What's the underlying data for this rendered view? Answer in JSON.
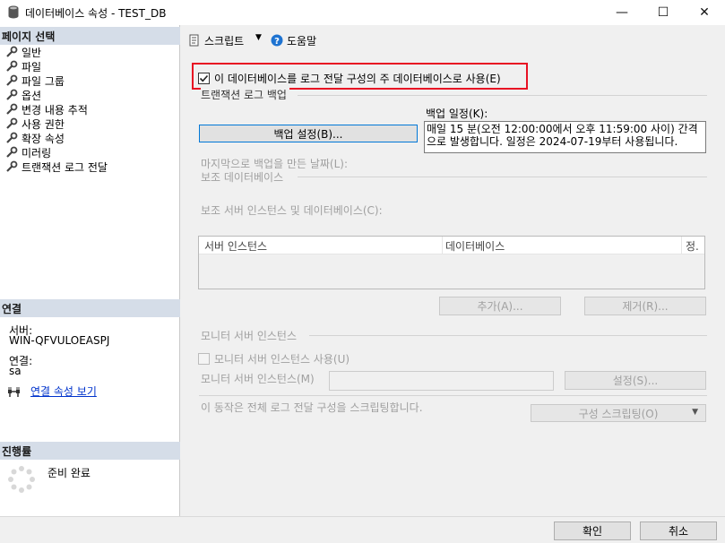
{
  "window": {
    "title": "데이터베이스 속성 - TEST_DB",
    "minimize": "—",
    "maximize": "☐",
    "close": "✕"
  },
  "left": {
    "page_select_header": "페이지 선택",
    "pages": [
      {
        "label": "일반"
      },
      {
        "label": "파일"
      },
      {
        "label": "파일 그룹"
      },
      {
        "label": "옵션"
      },
      {
        "label": "변경 내용 추적"
      },
      {
        "label": "사용 권한"
      },
      {
        "label": "확장 속성"
      },
      {
        "label": "미러링"
      },
      {
        "label": "트랜잭션 로그 전달"
      }
    ],
    "connection_header": "연결",
    "server_label": "서버:",
    "server_value": "WIN-QFVULOEASPJ",
    "connection_label": "연결:",
    "connection_value": "sa",
    "view_connection_properties": "연결 속성 보기",
    "progress_header": "진행률",
    "progress_status": "준비 완료"
  },
  "toolbar": {
    "script_label": "스크립트",
    "help_label": "도움말"
  },
  "main": {
    "enable_checkbox_label": "이 데이터베이스를 로그 전달 구성의 주 데이터베이스로 사용(E)",
    "enable_checked": true,
    "tlog_backup_group": "트랜잭션 로그 백업",
    "backup_settings_button": "백업 설정(B)...",
    "backup_schedule_label": "백업 일정(K):",
    "backup_schedule_text": "매일 15 분(오전 12:00:00에서 오후 11:59:00 사이) 간격으로 발생합니다. 일정은 2024-07-19부터 사용됩니다.",
    "last_backup_label": "마지막으로 백업을 만든 날짜(L):",
    "secondary_db_group": "보조 데이터베이스",
    "secondary_instances_label": "보조 서버 인스턴스 및 데이터베이스(C):",
    "grid_columns": [
      "서버 인스턴스",
      "데이터베이스",
      "정."
    ],
    "add_button": "추가(A)...",
    "remove_button": "제거(R)...",
    "monitor_group": "모니터 서버 인스턴스",
    "use_monitor_label": "모니터 서버 인스턴스 사용(U)",
    "monitor_instance_label": "모니터 서버 인스턴스(M)",
    "monitor_instance_value": "",
    "settings_button": "설정(S)...",
    "footer_note": "이 동작은 전체 로그 전달 구성을 스크립팅합니다.",
    "script_config_button": "구성 스크립팅(O)"
  },
  "footer": {
    "ok_button": "확인",
    "cancel_button": "취소"
  },
  "colors": {
    "highlight_border": "#e81123",
    "section_header_bg": "#d5dde8",
    "link": "#0033cc"
  }
}
